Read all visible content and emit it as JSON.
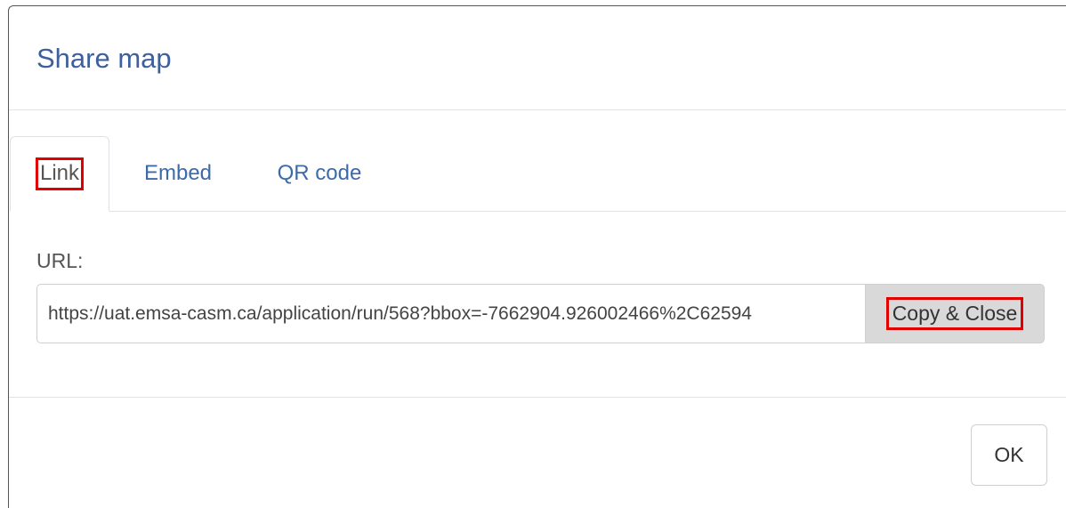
{
  "dialog": {
    "title": "Share map"
  },
  "tabs": [
    {
      "label": "Link",
      "active": true
    },
    {
      "label": "Embed",
      "active": false
    },
    {
      "label": "QR code",
      "active": false
    }
  ],
  "link": {
    "url_label": "URL:",
    "url_value": "https://uat.emsa-casm.ca/application/run/568?bbox=-7662904.926002466%2C62594",
    "copy_label": "Copy & Close"
  },
  "footer": {
    "ok_label": "OK"
  },
  "colors": {
    "title": "#3d5f9e",
    "tab_link": "#3d6aa8",
    "highlight": "#e00000",
    "copy_button_bg": "#d9d9d9"
  }
}
